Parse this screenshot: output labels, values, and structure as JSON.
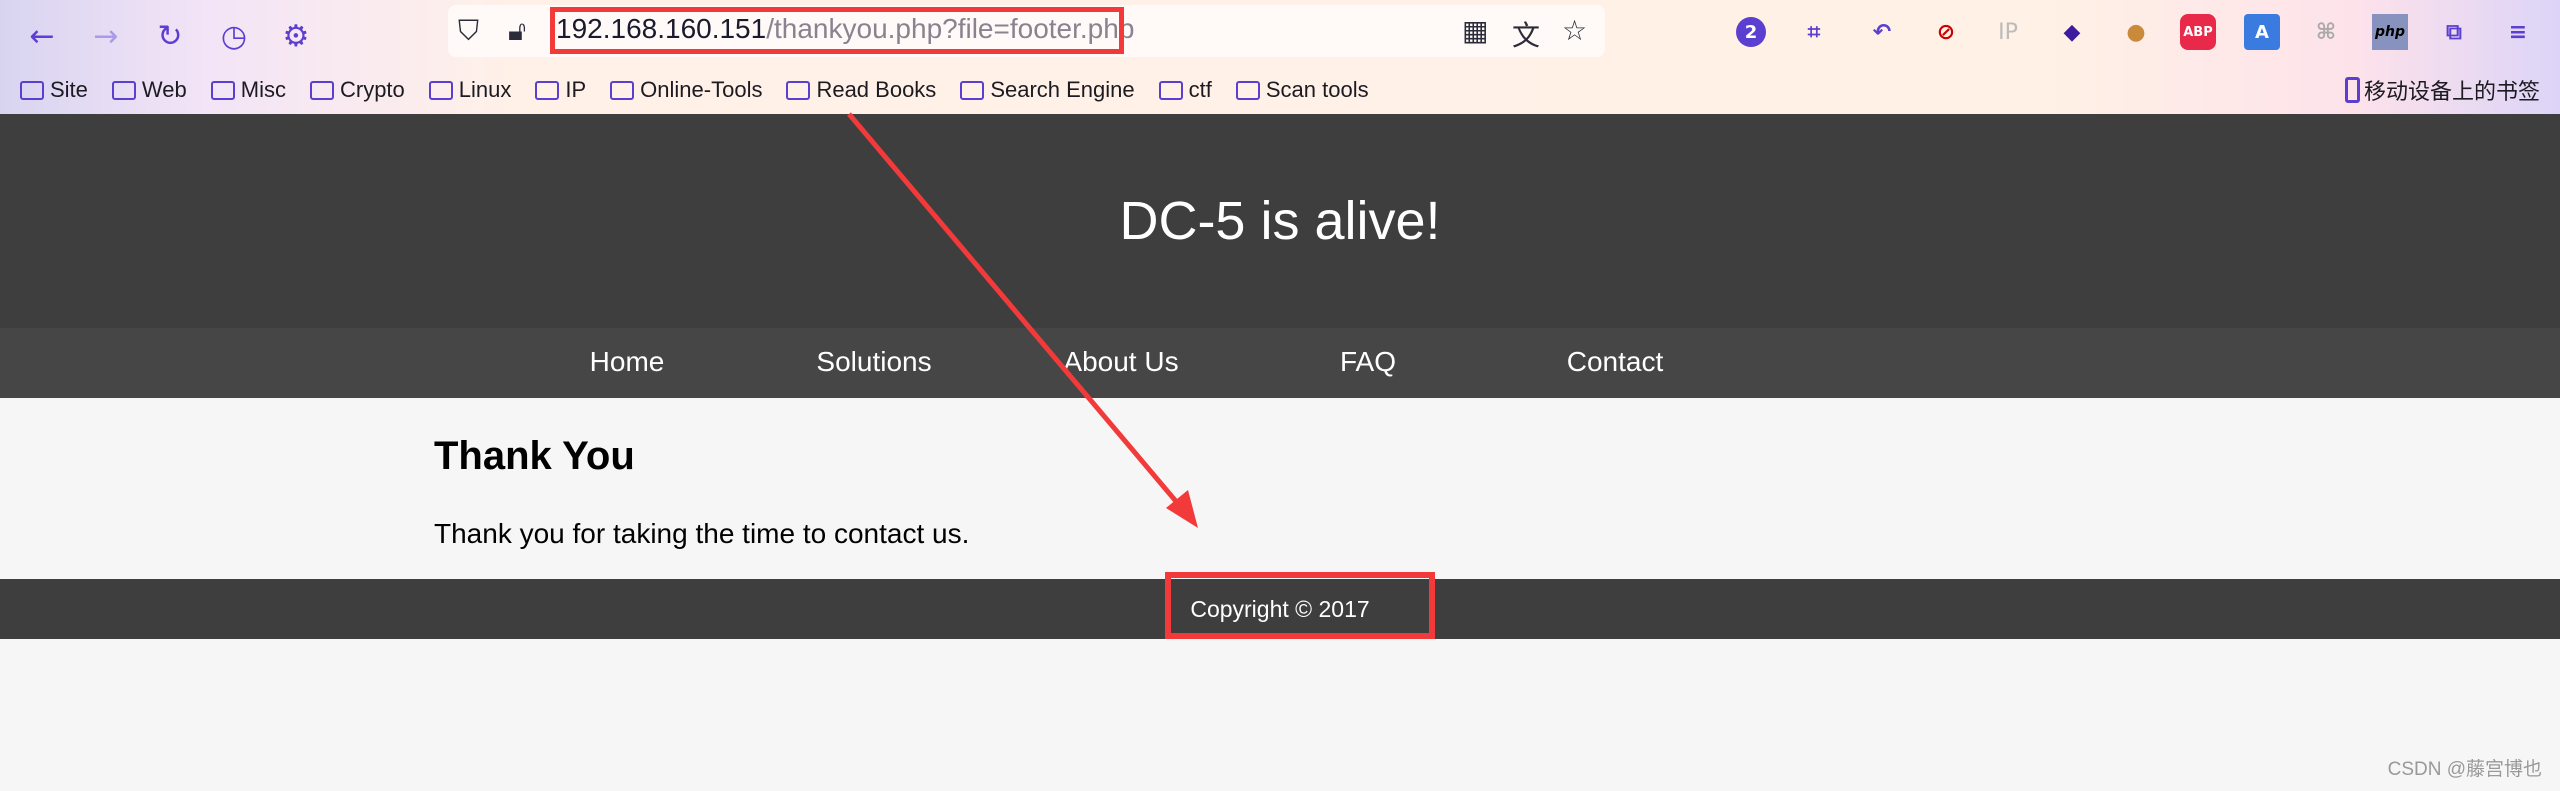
{
  "browser": {
    "url_host": "192.168.160.151",
    "url_path": "/thankyou.php?file=footer.php",
    "nav_icons": [
      "back-icon",
      "forward-icon",
      "reload-icon",
      "history-icon",
      "settings-icon"
    ],
    "extension_badge": "2",
    "ip_ext_label": "IP",
    "abp_label": "ABP",
    "php_label": "php",
    "bookmarks": [
      "Site",
      "Web",
      "Misc",
      "Crypto",
      "Linux",
      "IP",
      "Online-Tools",
      "Read Books",
      "Search Engine",
      "ctf",
      "Scan tools"
    ],
    "mobile_bookmarks": "移动设备上的书签"
  },
  "page": {
    "title": "DC-5 is alive!",
    "nav": [
      "Home",
      "Solutions",
      "About Us",
      "FAQ",
      "Contact"
    ],
    "heading": "Thank You",
    "message": "Thank you for taking the time to contact us.",
    "footer": "Copyright © 2017"
  },
  "annotation_color": "#f23a3a",
  "watermark": "CSDN @藤宫博也"
}
